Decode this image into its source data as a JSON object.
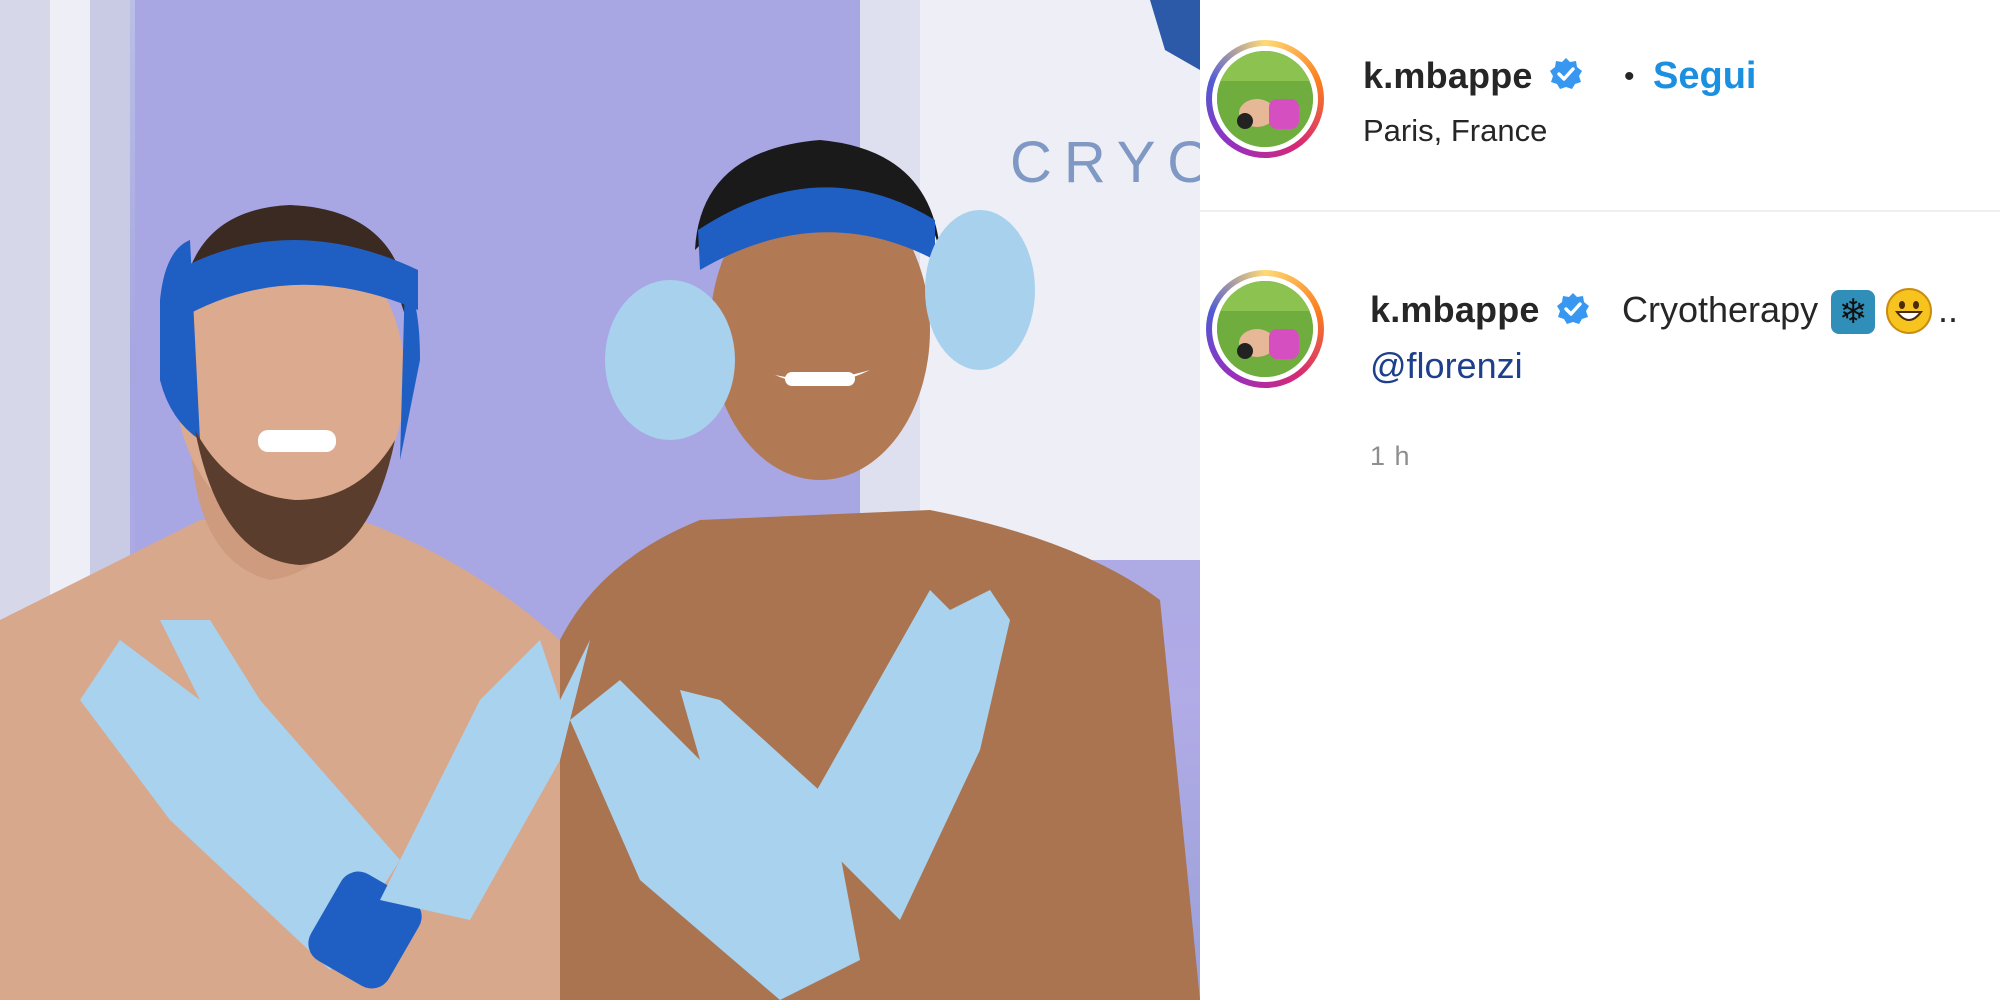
{
  "post": {
    "username": "k.mbappe",
    "follow_label": "Segui",
    "separator": "•",
    "location": "Paris, France",
    "caption_text": "Cryotherapy",
    "caption_emojis": [
      "snowflake-emoji",
      "grinning-face-emoji"
    ],
    "caption_overflow": "..",
    "mention": "@florenzi",
    "time_ago": "1 h",
    "photo_sign_text": "CRYO"
  },
  "colors": {
    "follow_blue": "#1b8fe0",
    "mention_blue": "#1e3f8a",
    "verified_blue": "#3897f0",
    "time_gray": "#8e8e8e",
    "glove_blue": "#a9d2ee",
    "headband_blue": "#1f5fc4"
  },
  "icons": {
    "verified": "verified-badge-icon"
  }
}
